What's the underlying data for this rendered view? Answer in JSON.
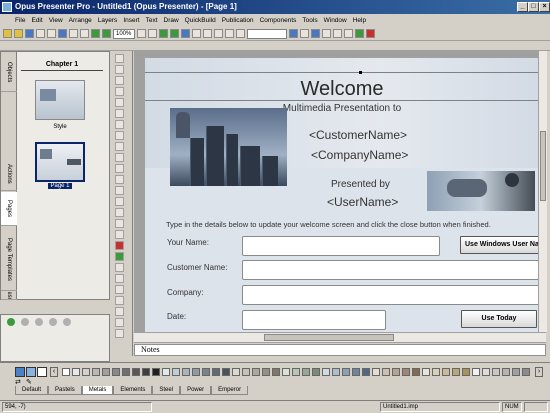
{
  "window": {
    "title": "Opus Presenter Pro - Untitled1 (Opus Presenter) - [Page 1]"
  },
  "menu": [
    "File",
    "Edit",
    "View",
    "Arrange",
    "Layers",
    "Insert",
    "Text",
    "Draw",
    "QuickBuild",
    "Publication",
    "Components",
    "Tools",
    "Window",
    "Help"
  ],
  "toolbar": {
    "zoom": "100%"
  },
  "side_tabs": [
    "Objects",
    "Actions",
    "Pages",
    "Page Templates",
    "Resou"
  ],
  "pages_panel": {
    "chapter": "Chapter 1",
    "style_label": "Style",
    "page_label": "Page 1"
  },
  "slide": {
    "title": "Welcome",
    "subtitle": "Multimedia Presentation to",
    "customer": "<CustomerName>",
    "company": "<CompanyName>",
    "presented_by": "Presented by",
    "user": "<UserName>",
    "instructions": "Type in the details below to update your welcome screen and click the close button when finished.",
    "labels": {
      "your_name": "Your Name:",
      "customer_name": "Customer Name:",
      "company": "Company:",
      "date": "Date:"
    },
    "use_windows_user": "Use Windows User Na",
    "use_today": "Use Today"
  },
  "notes_label": "Notes",
  "palette_tabs": [
    "Default",
    "Pastels",
    "Metals",
    "Elements",
    "Steel",
    "Power",
    "Emperor"
  ],
  "palette_active": "Metals",
  "colors": {
    "accent": "#0a246a",
    "chrome": "#d4d0c8"
  },
  "status": {
    "coords": "594, -7)",
    "file": "Untitled1.imp",
    "num": "NUM"
  }
}
